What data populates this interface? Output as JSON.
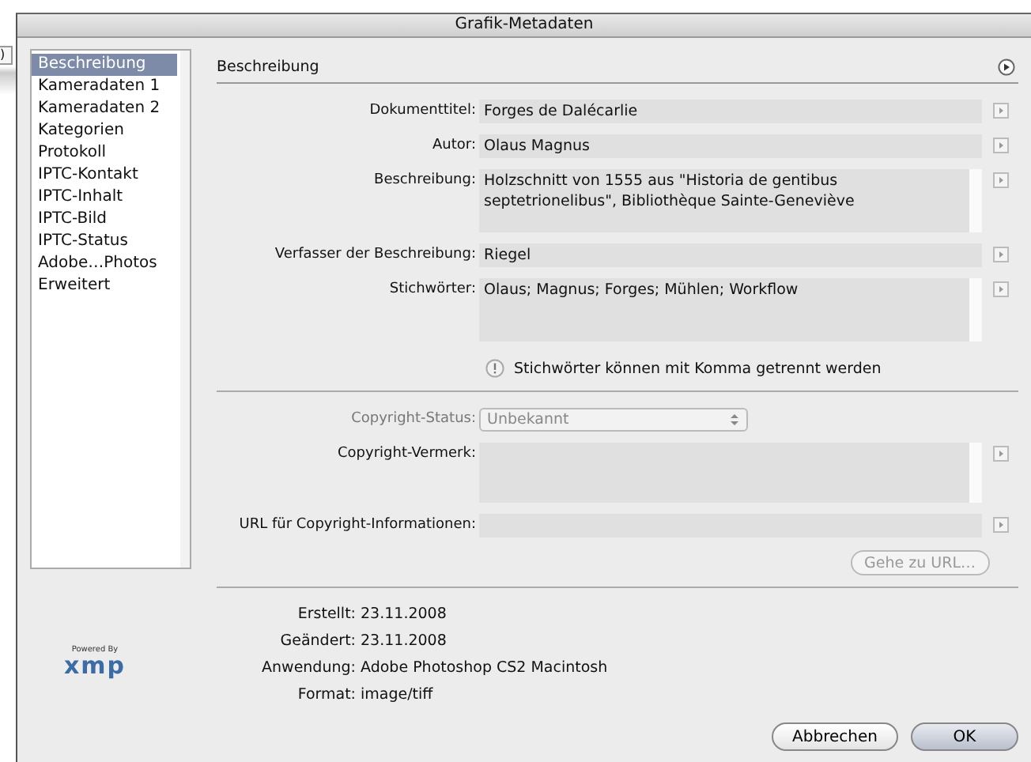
{
  "background_window": {
    "button_text": ")"
  },
  "window": {
    "title": "Grafik-Metadaten"
  },
  "sidebar": {
    "items": [
      {
        "label": "Beschreibung",
        "selected": true
      },
      {
        "label": "Kameradaten 1",
        "selected": false
      },
      {
        "label": "Kameradaten 2",
        "selected": false
      },
      {
        "label": "Kategorien",
        "selected": false
      },
      {
        "label": "Protokoll",
        "selected": false
      },
      {
        "label": "IPTC-Kontakt",
        "selected": false
      },
      {
        "label": "IPTC-Inhalt",
        "selected": false
      },
      {
        "label": "IPTC-Bild",
        "selected": false
      },
      {
        "label": "IPTC-Status",
        "selected": false
      },
      {
        "label": "Adobe…Photos",
        "selected": false
      },
      {
        "label": "Erweitert",
        "selected": false
      }
    ]
  },
  "panel": {
    "title": "Beschreibung",
    "fields": [
      {
        "label": "Dokumenttitel:",
        "value": "Forges de Dalécarlie",
        "kind": "single"
      },
      {
        "label": "Autor:",
        "value": "Olaus Magnus",
        "kind": "single"
      },
      {
        "label": "Beschreibung:",
        "value": "Holzschnitt von 1555 aus \"Historia de gentibus septetrionelibus\", Bibliothèque Sainte-Geneviève",
        "kind": "multi"
      },
      {
        "label": "Verfasser der Beschreibung:",
        "value": "Riegel",
        "kind": "single"
      },
      {
        "label": "Stichwörter:",
        "value": "Olaus; Magnus; Forges; Mühlen; Workflow",
        "kind": "multi"
      }
    ],
    "hint": "Stichwörter können mit Komma getrennt werden",
    "copyright_fields": [
      {
        "label": "Copyright-Status:",
        "value": "Unbekannt",
        "kind": "select"
      },
      {
        "label": "Copyright-Vermerk:",
        "kind": "multi"
      },
      {
        "label": "URL für Copyright-Informationen:",
        "kind": "single"
      }
    ],
    "goto_button": "Gehe zu URL…",
    "info": [
      {
        "label": "Erstellt:",
        "value": "23.11.2008"
      },
      {
        "label": "Geändert:",
        "value": "23.11.2008"
      },
      {
        "label": "Anwendung:",
        "value": "Adobe Photoshop CS2 Macintosh"
      },
      {
        "label": "Format:",
        "value": "image/tiff"
      }
    ]
  },
  "logo": {
    "caption": "Powered By",
    "text": "xmp"
  },
  "buttons": [
    {
      "label": "Abbrechen",
      "default": false
    },
    {
      "label": "OK",
      "default": true
    }
  ]
}
